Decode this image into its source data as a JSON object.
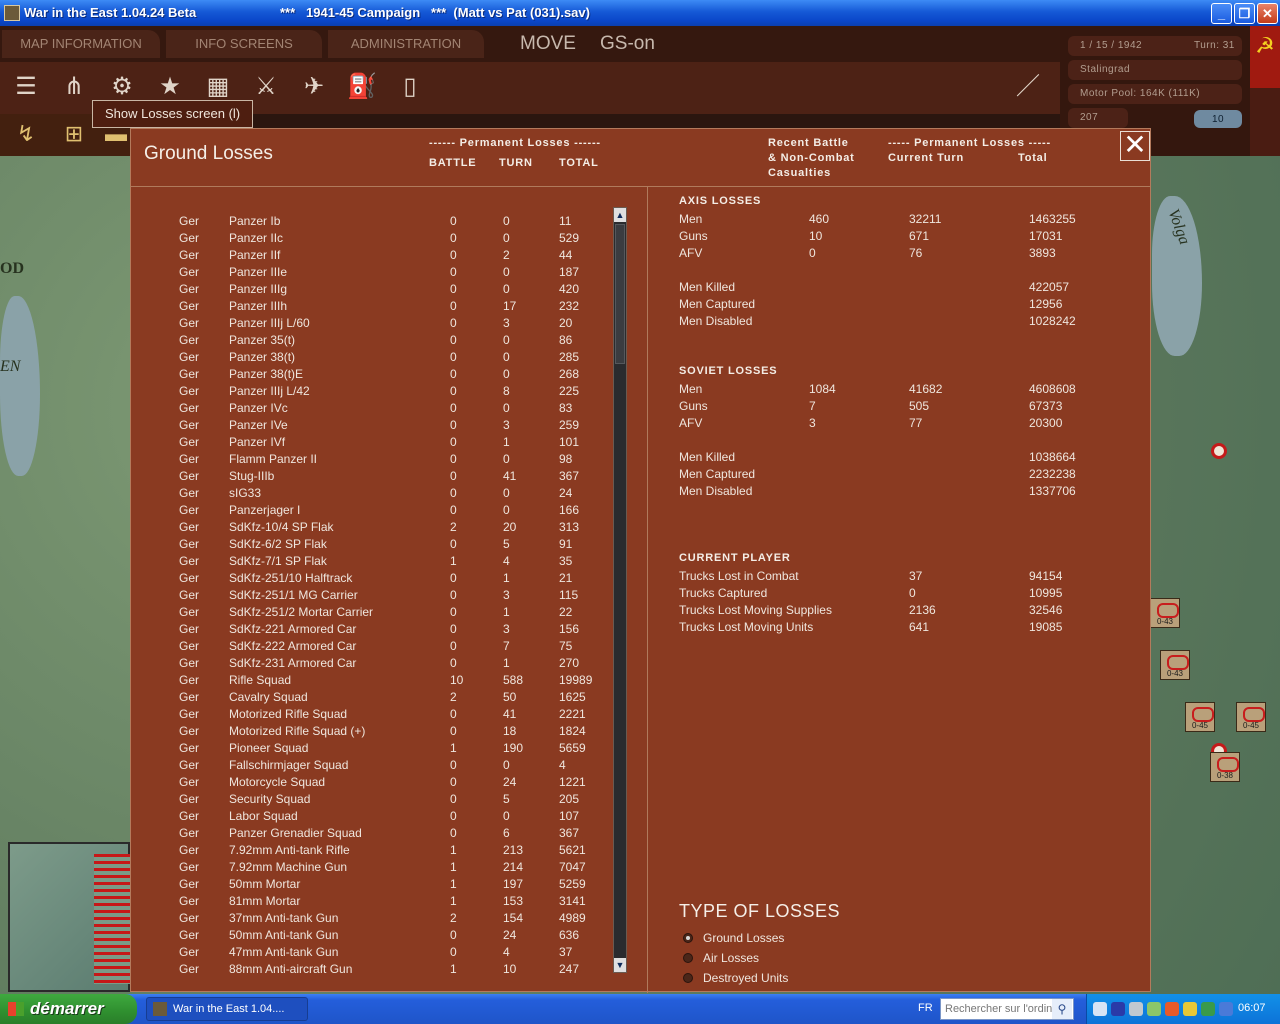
{
  "window": {
    "app_title": "War in the East 1.04.24 Beta",
    "campaign": "***   1941-45 Campaign   ***  (Matt vs Pat (031).sav)"
  },
  "menu": {
    "map_info": "MAP INFORMATION",
    "info_screens": "INFO SCREENS",
    "administration": "ADMINISTRATION",
    "mode": "MOVE",
    "gs": "GS-on"
  },
  "tooltip": "Show Losses screen (l)",
  "status": {
    "date": "1 / 15 / 1942",
    "turn": "Turn: 31",
    "location": "Stalingrad",
    "motor_pool": "Motor Pool: 164K (111K)",
    "value": "207",
    "count": "10"
  },
  "map_labels": {
    "a": "OD",
    "b": "EN",
    "c": "Volga"
  },
  "dialog": {
    "title": "Ground Losses",
    "left_group_header": "------ Permanent Losses ------",
    "col_battle": "BATTLE",
    "col_turn": "TURN",
    "col_total": "TOTAL",
    "right_col_recent": "Recent Battle\n& Non-Combat\nCasualties",
    "right_group_header": "----- Permanent Losses -----",
    "right_col_current": "Current Turn",
    "right_col_total": "Total",
    "close_symbol": "✕"
  },
  "unit_losses": [
    {
      "nation": "Ger",
      "name": "Panzer Ib",
      "battle": "0",
      "turn": "0",
      "total": "11"
    },
    {
      "nation": "Ger",
      "name": "Panzer IIc",
      "battle": "0",
      "turn": "0",
      "total": "529"
    },
    {
      "nation": "Ger",
      "name": "Panzer IIf",
      "battle": "0",
      "turn": "2",
      "total": "44"
    },
    {
      "nation": "Ger",
      "name": "Panzer IIIe",
      "battle": "0",
      "turn": "0",
      "total": "187"
    },
    {
      "nation": "Ger",
      "name": "Panzer IIIg",
      "battle": "0",
      "turn": "0",
      "total": "420"
    },
    {
      "nation": "Ger",
      "name": "Panzer IIIh",
      "battle": "0",
      "turn": "17",
      "total": "232"
    },
    {
      "nation": "Ger",
      "name": "Panzer IIIj L/60",
      "battle": "0",
      "turn": "3",
      "total": "20"
    },
    {
      "nation": "Ger",
      "name": "Panzer 35(t)",
      "battle": "0",
      "turn": "0",
      "total": "86"
    },
    {
      "nation": "Ger",
      "name": "Panzer 38(t)",
      "battle": "0",
      "turn": "0",
      "total": "285"
    },
    {
      "nation": "Ger",
      "name": "Panzer 38(t)E",
      "battle": "0",
      "turn": "0",
      "total": "268"
    },
    {
      "nation": "Ger",
      "name": "Panzer IIIj L/42",
      "battle": "0",
      "turn": "8",
      "total": "225"
    },
    {
      "nation": "Ger",
      "name": "Panzer IVc",
      "battle": "0",
      "turn": "0",
      "total": "83"
    },
    {
      "nation": "Ger",
      "name": "Panzer IVe",
      "battle": "0",
      "turn": "3",
      "total": "259"
    },
    {
      "nation": "Ger",
      "name": "Panzer IVf",
      "battle": "0",
      "turn": "1",
      "total": "101"
    },
    {
      "nation": "Ger",
      "name": "Flamm Panzer II",
      "battle": "0",
      "turn": "0",
      "total": "98"
    },
    {
      "nation": "Ger",
      "name": "Stug-IIIb",
      "battle": "0",
      "turn": "41",
      "total": "367"
    },
    {
      "nation": "Ger",
      "name": "sIG33",
      "battle": "0",
      "turn": "0",
      "total": "24"
    },
    {
      "nation": "Ger",
      "name": "Panzerjager I",
      "battle": "0",
      "turn": "0",
      "total": "166"
    },
    {
      "nation": "Ger",
      "name": "SdKfz-10/4 SP Flak",
      "battle": "2",
      "turn": "20",
      "total": "313"
    },
    {
      "nation": "Ger",
      "name": "SdKfz-6/2 SP Flak",
      "battle": "0",
      "turn": "5",
      "total": "91"
    },
    {
      "nation": "Ger",
      "name": "SdKfz-7/1 SP Flak",
      "battle": "1",
      "turn": "4",
      "total": "35"
    },
    {
      "nation": "Ger",
      "name": "SdKfz-251/10 Halftrack",
      "battle": "0",
      "turn": "1",
      "total": "21"
    },
    {
      "nation": "Ger",
      "name": "SdKfz-251/1 MG Carrier",
      "battle": "0",
      "turn": "3",
      "total": "115"
    },
    {
      "nation": "Ger",
      "name": "SdKfz-251/2 Mortar Carrier",
      "battle": "0",
      "turn": "1",
      "total": "22"
    },
    {
      "nation": "Ger",
      "name": "SdKfz-221 Armored Car",
      "battle": "0",
      "turn": "3",
      "total": "156"
    },
    {
      "nation": "Ger",
      "name": "SdKfz-222 Armored Car",
      "battle": "0",
      "turn": "7",
      "total": "75"
    },
    {
      "nation": "Ger",
      "name": "SdKfz-231 Armored Car",
      "battle": "0",
      "turn": "1",
      "total": "270"
    },
    {
      "nation": "Ger",
      "name": "Rifle Squad",
      "battle": "10",
      "turn": "588",
      "total": "19989"
    },
    {
      "nation": "Ger",
      "name": "Cavalry Squad",
      "battle": "2",
      "turn": "50",
      "total": "1625"
    },
    {
      "nation": "Ger",
      "name": "Motorized Rifle Squad",
      "battle": "0",
      "turn": "41",
      "total": "2221"
    },
    {
      "nation": "Ger",
      "name": "Motorized Rifle Squad (+)",
      "battle": "0",
      "turn": "18",
      "total": "1824"
    },
    {
      "nation": "Ger",
      "name": "Pioneer Squad",
      "battle": "1",
      "turn": "190",
      "total": "5659"
    },
    {
      "nation": "Ger",
      "name": "Fallschirmjager Squad",
      "battle": "0",
      "turn": "0",
      "total": "4"
    },
    {
      "nation": "Ger",
      "name": "Motorcycle Squad",
      "battle": "0",
      "turn": "24",
      "total": "1221"
    },
    {
      "nation": "Ger",
      "name": "Security Squad",
      "battle": "0",
      "turn": "5",
      "total": "205"
    },
    {
      "nation": "Ger",
      "name": "Labor Squad",
      "battle": "0",
      "turn": "0",
      "total": "107"
    },
    {
      "nation": "Ger",
      "name": "Panzer Grenadier Squad",
      "battle": "0",
      "turn": "6",
      "total": "367"
    },
    {
      "nation": "Ger",
      "name": "7.92mm Anti-tank Rifle",
      "battle": "1",
      "turn": "213",
      "total": "5621"
    },
    {
      "nation": "Ger",
      "name": "7.92mm Machine Gun",
      "battle": "1",
      "turn": "214",
      "total": "7047"
    },
    {
      "nation": "Ger",
      "name": "50mm Mortar",
      "battle": "1",
      "turn": "197",
      "total": "5259"
    },
    {
      "nation": "Ger",
      "name": "81mm Mortar",
      "battle": "1",
      "turn": "153",
      "total": "3141"
    },
    {
      "nation": "Ger",
      "name": "37mm Anti-tank Gun",
      "battle": "2",
      "turn": "154",
      "total": "4989"
    },
    {
      "nation": "Ger",
      "name": "50mm Anti-tank Gun",
      "battle": "0",
      "turn": "24",
      "total": "636"
    },
    {
      "nation": "Ger",
      "name": "47mm Anti-tank Gun",
      "battle": "0",
      "turn": "4",
      "total": "37"
    },
    {
      "nation": "Ger",
      "name": "88mm Anti-aircraft Gun",
      "battle": "1",
      "turn": "10",
      "total": "247"
    }
  ],
  "axis": {
    "header": "AXIS LOSSES",
    "rows": [
      {
        "label": "Men",
        "recent": "460",
        "current": "32211",
        "total": "1463255"
      },
      {
        "label": "Guns",
        "recent": "10",
        "current": "671",
        "total": "17031"
      },
      {
        "label": "AFV",
        "recent": "0",
        "current": "76",
        "total": "3893"
      }
    ],
    "killed": {
      "label": "Men Killed",
      "total": "422057"
    },
    "captured": {
      "label": "Men Captured",
      "total": "12956"
    },
    "disabled": {
      "label": "Men Disabled",
      "total": "1028242"
    }
  },
  "soviet": {
    "header": "SOVIET LOSSES",
    "rows": [
      {
        "label": "Men",
        "recent": "1084",
        "current": "41682",
        "total": "4608608"
      },
      {
        "label": "Guns",
        "recent": "7",
        "current": "505",
        "total": "67373"
      },
      {
        "label": "AFV",
        "recent": "3",
        "current": "77",
        "total": "20300"
      }
    ],
    "killed": {
      "label": "Men Killed",
      "total": "1038664"
    },
    "captured": {
      "label": "Men Captured",
      "total": "2232238"
    },
    "disabled": {
      "label": "Men Disabled",
      "total": "1337706"
    }
  },
  "current_player": {
    "header": "CURRENT PLAYER",
    "rows": [
      {
        "label": "Trucks Lost in Combat",
        "current": "37",
        "total": "94154"
      },
      {
        "label": "Trucks Captured",
        "current": "0",
        "total": "10995"
      },
      {
        "label": "Trucks Lost Moving Supplies",
        "current": "2136",
        "total": "32546"
      },
      {
        "label": "Trucks Lost Moving Units",
        "current": "641",
        "total": "19085"
      }
    ]
  },
  "loss_types": {
    "header": "TYPE OF LOSSES",
    "options": [
      {
        "label": "Ground Losses",
        "selected": true
      },
      {
        "label": "Air Losses",
        "selected": false
      },
      {
        "label": "Destroyed Units",
        "selected": false
      }
    ]
  },
  "map_units": [
    "0-43",
    "0-43",
    "0-45",
    "0-45",
    "0-38"
  ],
  "taskbar": {
    "start": "démarrer",
    "task": "War in the East 1.04....",
    "lang": "FR",
    "search_placeholder": "Rechercher sur l'ordin",
    "clock": "06:07"
  }
}
